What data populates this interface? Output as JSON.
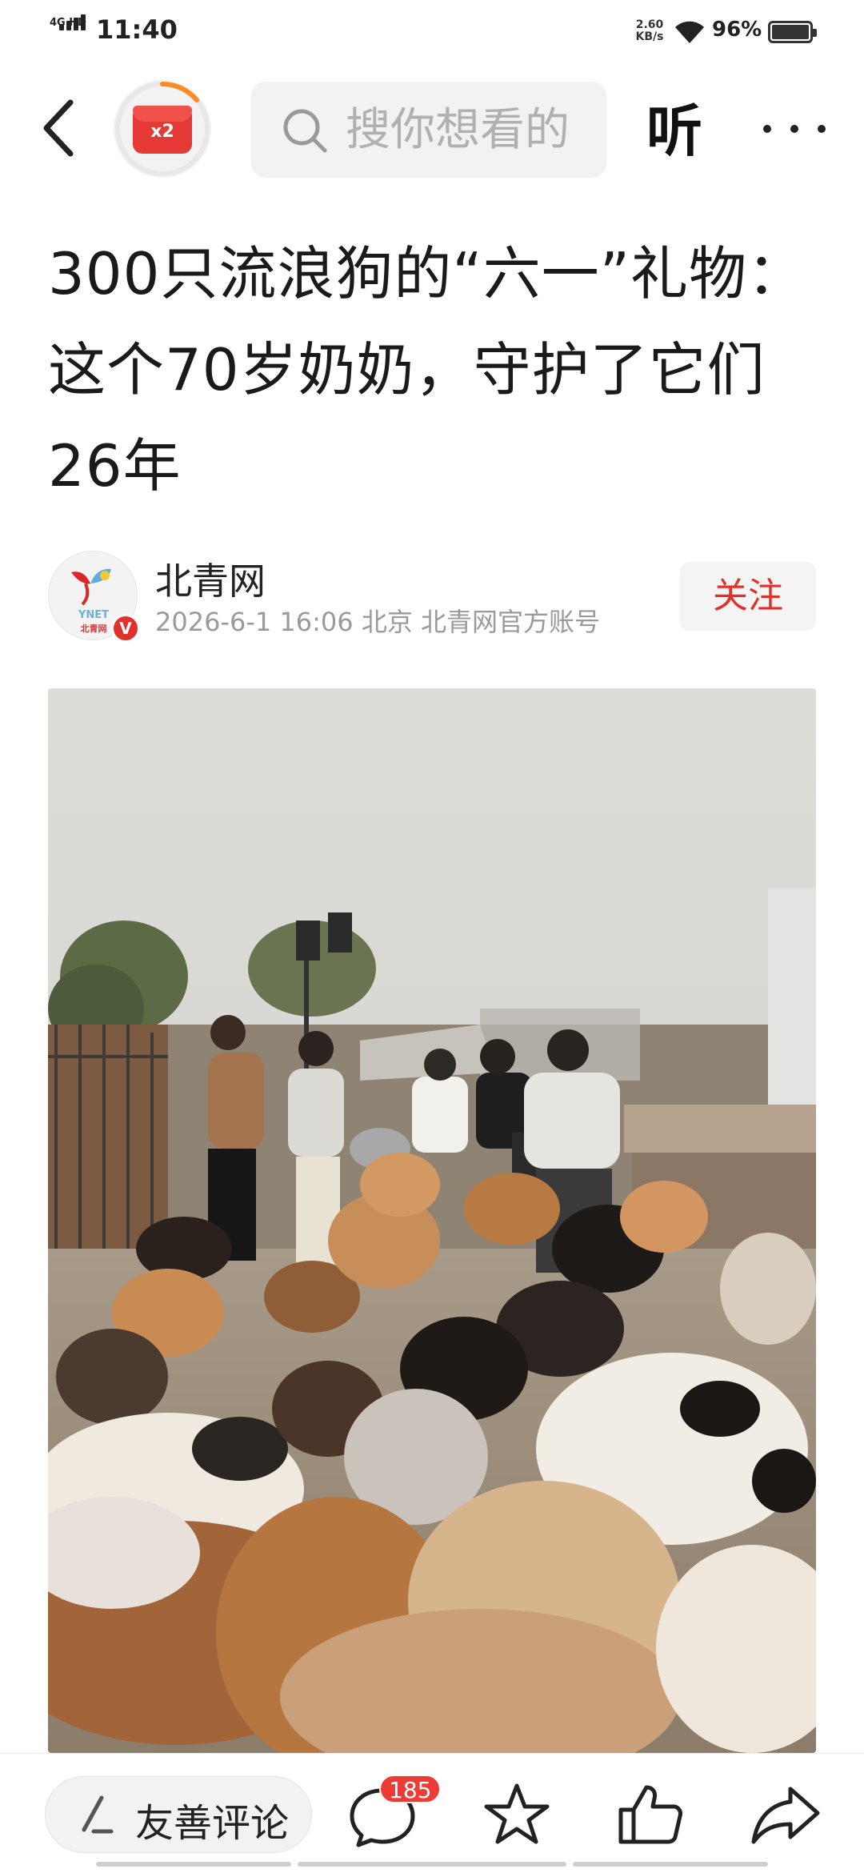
{
  "status_bar": {
    "network_type": "4G HD",
    "time": "11:40",
    "net_speed_value": "2.60",
    "net_speed_unit": "KB/s",
    "battery_percent": "96%",
    "icons": [
      "signal-icon",
      "wifi-icon",
      "battery-icon"
    ]
  },
  "header": {
    "back_icon": "back-arrow-icon",
    "reward_badge_text": "x2",
    "search_placeholder": "搜你想看的",
    "listen_label": "听",
    "more_icon": "more-dots-icon"
  },
  "article": {
    "title": "300只流浪狗的“六一”礼物：这个70岁奶奶，守护了它们26年",
    "author": {
      "name": "北青网",
      "avatar_text_top": "YNET",
      "avatar_text_bottom": "北青网",
      "verified_mark": "V",
      "meta": "2026-6-1  16:06  北京  北青网官方账号"
    },
    "follow_label": "关注",
    "photo_alt": "dogs-photo"
  },
  "bottom_bar": {
    "comment_placeholder": "友善评论",
    "comment_count": "185",
    "icons": [
      "pen-icon",
      "comment-icon",
      "star-icon",
      "like-icon",
      "share-icon"
    ]
  },
  "colors": {
    "accent_red": "#e0312b",
    "badge_red": "#ef3b35",
    "search_bg": "#f2f2f2",
    "meta_gray": "#9a9a9a"
  }
}
